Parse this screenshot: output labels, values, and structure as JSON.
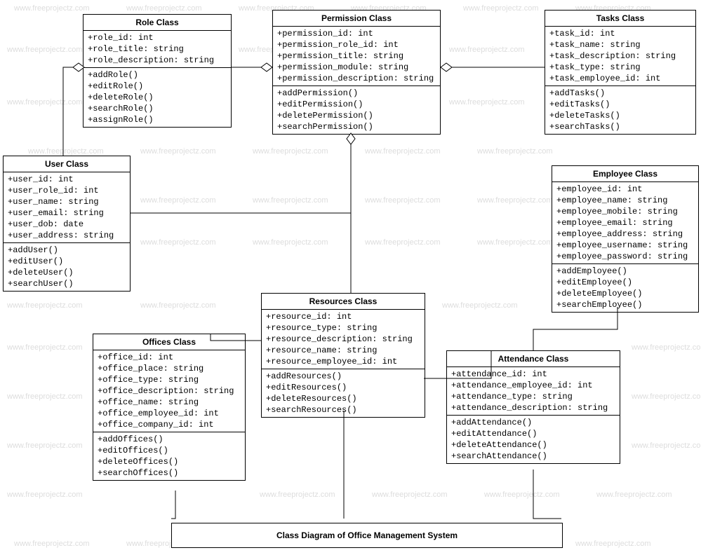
{
  "watermarks": [
    "www.freeprojectz.com"
  ],
  "caption": "Class Diagram of Office Management System",
  "classes": {
    "role": {
      "title": "Role Class",
      "attrs": [
        "+role_id: int",
        "+role_title: string",
        "+role_description: string"
      ],
      "ops": [
        "+addRole()",
        "+editRole()",
        "+deleteRole()",
        "+searchRole()",
        "+assignRole()"
      ]
    },
    "permission": {
      "title": "Permission Class",
      "attrs": [
        "+permission_id: int",
        "+permission_role_id: int",
        "+permission_title: string",
        "+permission_module: string",
        "+permission_description: string"
      ],
      "ops": [
        "+addPermission()",
        "+editPermission()",
        "+deletePermission()",
        "+searchPermission()"
      ]
    },
    "tasks": {
      "title": "Tasks Class",
      "attrs": [
        "+task_id: int",
        "+task_name: string",
        "+task_description: string",
        "+task_type: string",
        "+task_employee_id: int"
      ],
      "ops": [
        "+addTasks()",
        "+editTasks()",
        "+deleteTasks()",
        "+searchTasks()"
      ]
    },
    "user": {
      "title": "User Class",
      "attrs": [
        "+user_id: int",
        "+user_role_id: int",
        "+user_name: string",
        "+user_email: string",
        "+user_dob: date",
        "+user_address: string"
      ],
      "ops": [
        "+addUser()",
        "+editUser()",
        "+deleteUser()",
        "+searchUser()"
      ]
    },
    "employee": {
      "title": "Employee Class",
      "attrs": [
        "+employee_id: int",
        "+employee_name: string",
        "+employee_mobile: string",
        "+employee_email: string",
        "+employee_address: string",
        "+employee_username: string",
        "+employee_password: string"
      ],
      "ops": [
        "+addEmployee()",
        "+editEmployee()",
        "+deleteEmployee()",
        "+searchEmployee()"
      ]
    },
    "resources": {
      "title": "Resources Class",
      "attrs": [
        "+resource_id: int",
        "+resource_type: string",
        "+resource_description: string",
        "+resource_name: string",
        "+resource_employee_id: int"
      ],
      "ops": [
        "+addResources()",
        "+editResources()",
        "+deleteResources()",
        "+searchResources()"
      ]
    },
    "offices": {
      "title": "Offices Class",
      "attrs": [
        "+office_id: int",
        "+office_place: string",
        "+office_type: string",
        "+office_description: string",
        "+office_name: string",
        "+office_employee_id: int",
        "+office_company_id: int"
      ],
      "ops": [
        "+addOffices()",
        "+editOffices()",
        "+deleteOffices()",
        "+searchOffices()"
      ]
    },
    "attendance": {
      "title": "Attendance Class",
      "attrs": [
        "+attendance_id: int",
        "+attendance_employee_id: int",
        "+attendance_type: string",
        "+attendance_description: string"
      ],
      "ops": [
        "+addAttendance()",
        "+editAttendance()",
        "+deleteAttendance()",
        "+searchAttendance()"
      ]
    }
  }
}
